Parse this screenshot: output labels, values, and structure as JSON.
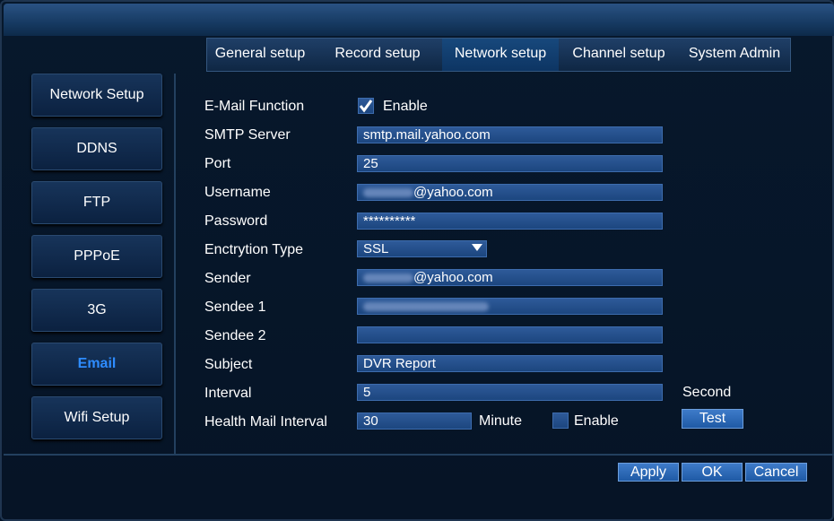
{
  "tabs": [
    "General setup",
    "Record setup",
    "Network setup",
    "Channel setup",
    "System Admin"
  ],
  "active_tab": "Network setup",
  "sidebar": {
    "items": [
      "Network Setup",
      "DDNS",
      "FTP",
      "PPPoE",
      "3G",
      "Email",
      "Wifi Setup"
    ],
    "active": "Email"
  },
  "form": {
    "email_function": {
      "label": "E-Mail Function",
      "checkbox_label": "Enable",
      "checked": true
    },
    "smtp_server": {
      "label": "SMTP Server",
      "value": "smtp.mail.yahoo.com"
    },
    "port": {
      "label": "Port",
      "value": "25"
    },
    "username": {
      "label": "Username",
      "value": "@yahoo.com"
    },
    "password": {
      "label": "Password",
      "value": "**********"
    },
    "encryption": {
      "label": "Enctrytion Type",
      "value": "SSL"
    },
    "sender": {
      "label": "Sender",
      "value": "@yahoo.com"
    },
    "sendee1": {
      "label": "Sendee 1",
      "value": ""
    },
    "sendee2": {
      "label": "Sendee 2",
      "value": ""
    },
    "subject": {
      "label": "Subject",
      "value": "DVR Report"
    },
    "interval": {
      "label": "Interval",
      "value": "5",
      "unit": "Second"
    },
    "health_mail": {
      "label": "Health Mail Interval",
      "value": "30",
      "unit": "Minute",
      "checkbox_label": "Enable",
      "checked": false
    },
    "test_button": "Test"
  },
  "footer": {
    "apply": "Apply",
    "ok": "OK",
    "cancel": "Cancel"
  }
}
